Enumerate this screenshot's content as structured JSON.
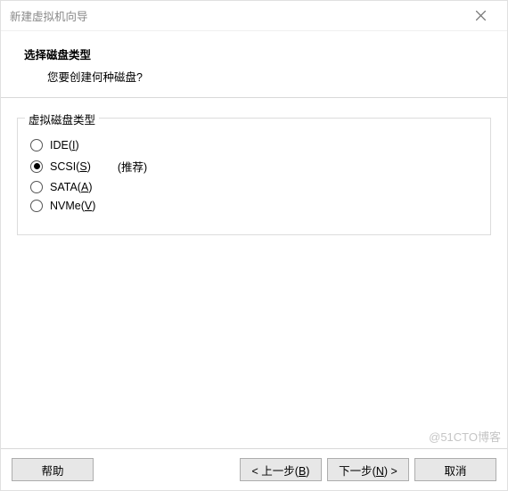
{
  "window": {
    "title": "新建虚拟机向导"
  },
  "header": {
    "title": "选择磁盘类型",
    "subtitle": "您要创建何种磁盘?"
  },
  "group": {
    "legend": "虚拟磁盘类型",
    "options": [
      {
        "label_pre": "IDE(",
        "key": "I",
        "label_post": ")",
        "selected": false,
        "hint": ""
      },
      {
        "label_pre": "SCSI(",
        "key": "S",
        "label_post": ")",
        "selected": true,
        "hint": "(推荐)"
      },
      {
        "label_pre": "SATA(",
        "key": "A",
        "label_post": ")",
        "selected": false,
        "hint": ""
      },
      {
        "label_pre": "NVMe(",
        "key": "V",
        "label_post": ")",
        "selected": false,
        "hint": ""
      }
    ]
  },
  "buttons": {
    "help": "帮助",
    "back_pre": "< 上一步(",
    "back_key": "B",
    "back_post": ")",
    "next_pre": "下一步(",
    "next_key": "N",
    "next_post": ") >",
    "cancel": "取消"
  },
  "watermark": "@51CTO博客"
}
